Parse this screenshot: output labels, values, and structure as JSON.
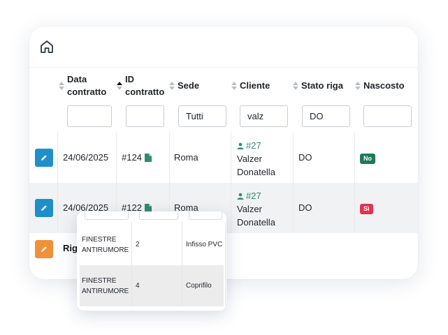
{
  "headers": {
    "data": "Data contratto",
    "id": "ID contratto",
    "sede": "Sede",
    "cliente": "Cliente",
    "stato": "Stato riga",
    "nascosto": "Nascosto"
  },
  "filters": {
    "data": "",
    "id": "",
    "sede": "Tutti",
    "cliente": "valz",
    "stato": "DO",
    "nascosto": ""
  },
  "rows": [
    {
      "data": "24/06/2025",
      "id": "#124",
      "sede": "Roma",
      "cliente_id": "#27",
      "cliente_nome": "Valzer Donatella",
      "stato": "DO",
      "nascosto": "No",
      "nascosto_color": "#1f7a55"
    },
    {
      "data": "24/06/2025",
      "id": "#122",
      "sede": "Roma",
      "cliente_id": "#27",
      "cliente_nome": "Valzer Donatella",
      "stato": "DO",
      "nascosto": "Sì",
      "nascosto_color": "#e0354f"
    }
  ],
  "righe_label": "Rig",
  "colors": {
    "edit_blue": "#1e8fc9",
    "edit_orange": "#f0913a",
    "client_green": "#2e8b6e"
  },
  "icons": {
    "home": "home-icon",
    "edit": "pencil-icon",
    "document": "document-icon",
    "user": "user-icon"
  },
  "popup": {
    "rows": [
      {
        "descr": "FINESTRE ANTIRUMORE",
        "qty": "2",
        "tipo": "Infisso PVC"
      },
      {
        "descr": "FINESTRE ANTIRUMORE",
        "qty": "4",
        "tipo": "Coprifilo"
      }
    ]
  }
}
